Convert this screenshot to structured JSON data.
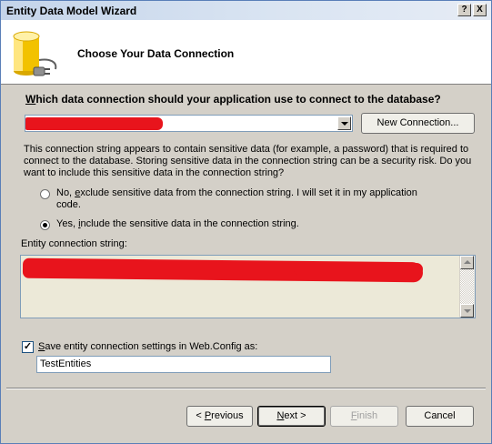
{
  "window": {
    "title": "Entity Data Model Wizard",
    "help_glyph": "?",
    "close_glyph": "X"
  },
  "header": {
    "title": "Choose Your Data Connection",
    "icon": "database-connection-icon"
  },
  "question": {
    "prefix": "W",
    "rest": "hich data connection should your application use to connect to the database?"
  },
  "connection": {
    "selected_value": "",
    "new_connection_label": "New Connection..."
  },
  "info_text": "This connection string appears to contain sensitive data (for example, a password) that is required to connect to the database. Storing sensitive data in the connection string can be a security risk. Do you want to include this sensitive data in the connection string?",
  "options": {
    "exclude": {
      "pre": "No, ",
      "accel": "e",
      "post": "xclude sensitive data from the connection string. I will set it in my application code.",
      "selected": false
    },
    "include": {
      "pre": "Yes, ",
      "accel": "i",
      "post": "nclude the sensitive data in the connection string.",
      "selected": true
    }
  },
  "entity_connection": {
    "label": "Entity connection string:",
    "value": ""
  },
  "save_settings": {
    "checked": true,
    "check_glyph": "✓",
    "accel": "S",
    "label_rest": "ave entity connection settings in Web.Config as:",
    "name_value": "TestEntities"
  },
  "buttons": {
    "previous": {
      "pre": "< ",
      "accel": "P",
      "post": "revious"
    },
    "next": {
      "accel": "N",
      "post": "ext >"
    },
    "finish": {
      "accel": "F",
      "post": "inish"
    },
    "cancel": "Cancel"
  },
  "colors": {
    "redaction": "#e8141c",
    "dialog_bg": "#d4d0c8",
    "title_bar": "#c4d4ea"
  }
}
